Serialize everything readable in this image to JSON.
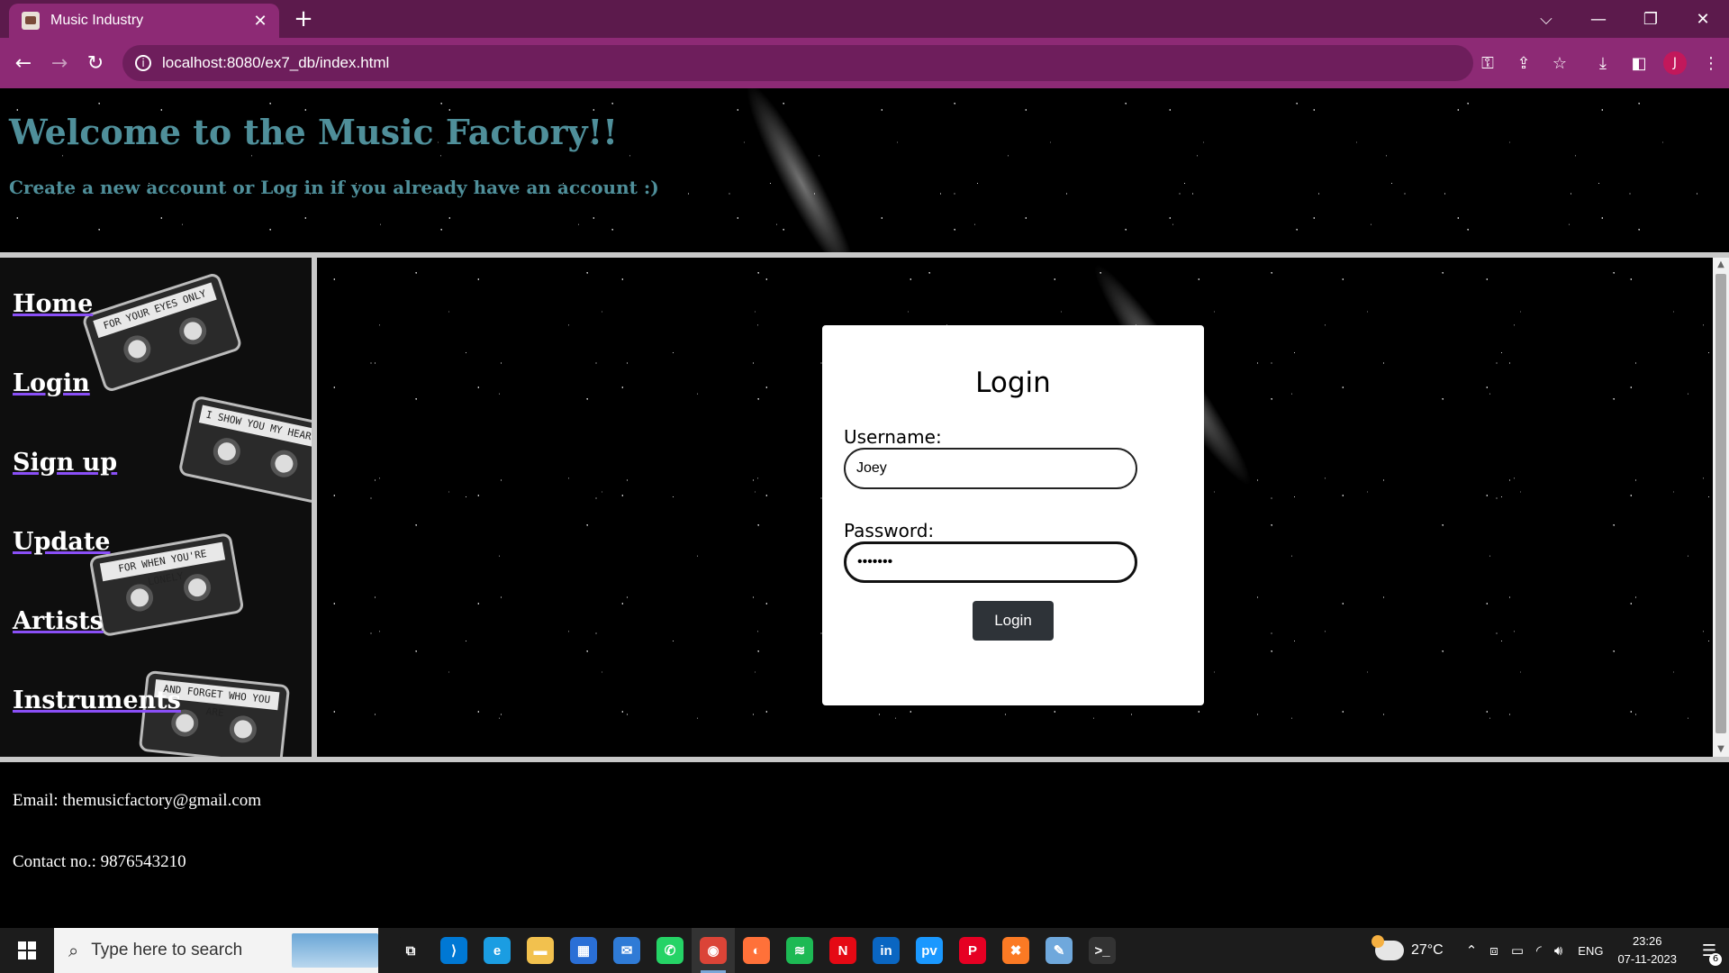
{
  "browser": {
    "tab_title": "Music Industry",
    "tab_close": "✕",
    "new_tab": "+",
    "url": "localhost:8080/ex7_db/index.html",
    "avatar_letter": "J",
    "window_controls": [
      "⌵",
      "—",
      "❐",
      "✕"
    ]
  },
  "header": {
    "title": "Welcome to the Music Factory!!",
    "subtitle": "Create a new account or Log in if you already have an account :)",
    "title_color": "#4f8f9a"
  },
  "sidebar": {
    "links": [
      "Home",
      "Login",
      "Sign up",
      "Update",
      "Artists",
      "Instruments"
    ],
    "cassette_labels": [
      "FOR YOUR EYES ONLY",
      "I SHOW YOU MY HEART",
      "FOR WHEN YOU'RE LONELY",
      "AND FORGET WHO YOU ARE"
    ]
  },
  "login": {
    "title": "Login",
    "username_label": "Username:",
    "username_value": "Joey",
    "password_label": "Password:",
    "password_value": "•••••••",
    "button_label": "Login"
  },
  "footer": {
    "email": "Email: themusicfactory@gmail.com",
    "contact": "Contact no.: 9876543210"
  },
  "taskbar": {
    "search_placeholder": "Type here to search",
    "apps": [
      {
        "name": "task-view",
        "glyph": "⧉",
        "color": "#1c1c1c"
      },
      {
        "name": "vscode",
        "glyph": "⟩",
        "color": "#0078d4"
      },
      {
        "name": "edge",
        "glyph": "e",
        "color": "#1b9de2"
      },
      {
        "name": "file-explorer",
        "glyph": "▬",
        "color": "#f2c14e"
      },
      {
        "name": "ms-store",
        "glyph": "▦",
        "color": "#2a6fd6"
      },
      {
        "name": "mail",
        "glyph": "✉",
        "color": "#2f7bd6"
      },
      {
        "name": "whatsapp",
        "glyph": "✆",
        "color": "#25d366"
      },
      {
        "name": "chrome",
        "glyph": "◉",
        "color": "#db4437"
      },
      {
        "name": "firefox",
        "glyph": "◐",
        "color": "#ff7139"
      },
      {
        "name": "spotify",
        "glyph": "≋",
        "color": "#1db954"
      },
      {
        "name": "netflix",
        "glyph": "N",
        "color": "#e50914"
      },
      {
        "name": "linkedin",
        "glyph": "in",
        "color": "#0a66c2"
      },
      {
        "name": "prime-video",
        "glyph": "pv",
        "color": "#1a98ff"
      },
      {
        "name": "pinterest",
        "glyph": "P",
        "color": "#e60023"
      },
      {
        "name": "xampp",
        "glyph": "✖",
        "color": "#fb7a24"
      },
      {
        "name": "paint",
        "glyph": "✎",
        "color": "#6fa8dc"
      },
      {
        "name": "terminal",
        "glyph": ">_",
        "color": "#333333"
      }
    ],
    "temperature": "27°C",
    "language": "ENG",
    "time": "23:26",
    "date": "07-11-2023",
    "notification_count": "6"
  }
}
